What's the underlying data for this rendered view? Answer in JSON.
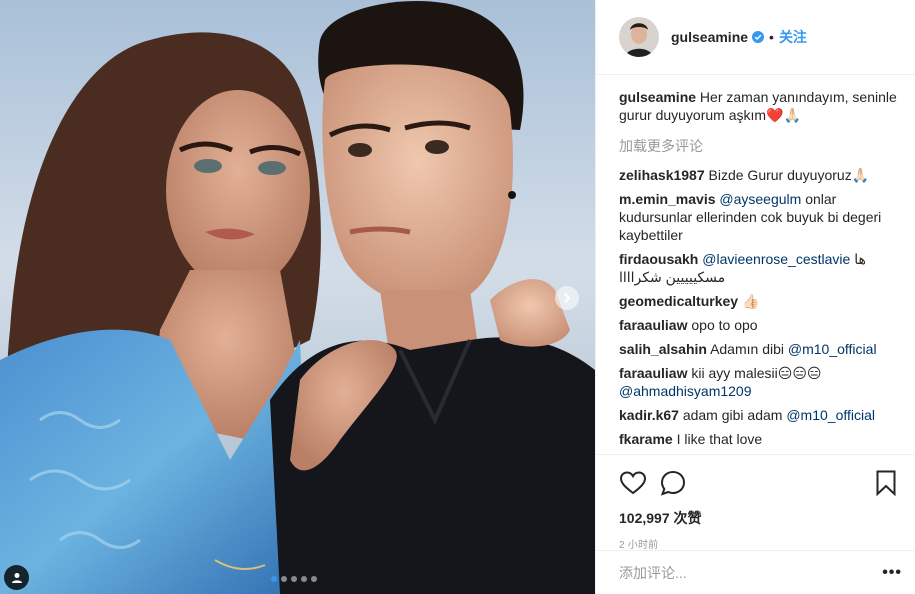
{
  "header": {
    "username": "gulseamine",
    "separator": "•",
    "follow_label": "关注"
  },
  "caption": {
    "username": "gulseamine",
    "text": "Her zaman yanındayım, seninle gurur duyuyorum aşkım❤️🙏🏻"
  },
  "load_more_label": "加载更多评论",
  "comments": [
    {
      "user": "zelihask1987",
      "text": "Bizde Gurur duyuyoruz🙏🏻",
      "mention": ""
    },
    {
      "user": "m.emin_mavis",
      "text": "",
      "mention": "@ayseegulm",
      "text_after": " onlar kudursunlar ellerinden cok buyuk bi degeri kaybettiler"
    },
    {
      "user": "firdaousakh",
      "text": "",
      "mention": "@lavieenrose_cestlavie",
      "text_after": " ها مسكييييين شكراااا"
    },
    {
      "user": "geomedicalturkey",
      "text": "👍🏻",
      "mention": ""
    },
    {
      "user": "faraauliaw",
      "text": "opo to opo",
      "mention": ""
    },
    {
      "user": "salih_alsahin",
      "text": "Adamın dibi ",
      "mention": "@m10_official"
    },
    {
      "user": "faraauliaw",
      "text": "kii ayy malesii😑😑😑",
      "mention": "@ahmadhisyam1209"
    },
    {
      "user": "kadir.k67",
      "text": "adam gibi adam ",
      "mention": "@m10_official"
    },
    {
      "user": "fkarame",
      "text": "I like that love",
      "mention": ""
    }
  ],
  "likes": "102,997 次赞",
  "time": "2 小时前",
  "add_comment": {
    "placeholder": "添加评论...",
    "more_label": "•••"
  },
  "icons": {
    "like": "heart-outline-icon",
    "comment": "speech-bubble-icon",
    "save": "bookmark-icon",
    "verified": "verified-badge-icon",
    "tag": "user-tag-icon",
    "next": "chevron-right-icon"
  },
  "carousel": {
    "count": 5,
    "active": 0
  },
  "colors": {
    "accent": "#3897f0",
    "mention": "#003569",
    "muted": "#999999"
  }
}
